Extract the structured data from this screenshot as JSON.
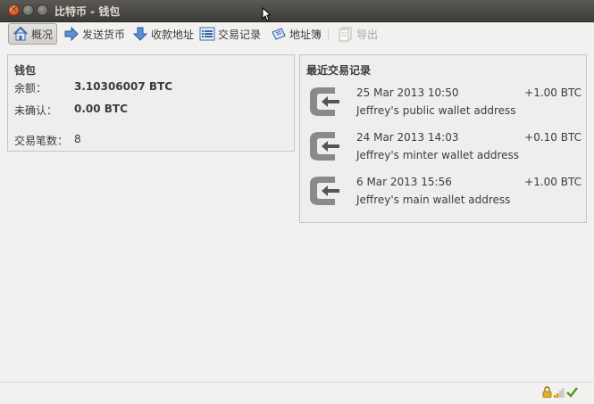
{
  "window": {
    "title": "比特币 - 钱包"
  },
  "toolbar": {
    "overview": "概况",
    "send": "发送货币",
    "receive": "收款地址",
    "transactions": "交易记录",
    "address_book": "地址簿",
    "export": "导出"
  },
  "wallet": {
    "title": "钱包",
    "balance_label": "余额：",
    "balance_value": "3.10306007 BTC",
    "unconfirmed_label": "未确认：",
    "unconfirmed_value": "0.00 BTC",
    "count_label": "交易笔数：",
    "count_value": "8"
  },
  "recent": {
    "title": "最近交易记录",
    "items": [
      {
        "date": "25 Mar 2013 10:50",
        "amount": "+1.00 BTC",
        "address": "Jeffrey's public wallet address"
      },
      {
        "date": "24 Mar 2013 14:03",
        "amount": "+0.10 BTC",
        "address": "Jeffrey's minter wallet address"
      },
      {
        "date": "6 Mar 2013 15:56",
        "amount": "+1.00 BTC",
        "address": "Jeffrey's main wallet address"
      }
    ]
  },
  "colors": {
    "titlebar": "#3d3c38",
    "close_button": "#e0541f",
    "status_ok": "#4a9a1c",
    "lock": "#d4a017"
  }
}
